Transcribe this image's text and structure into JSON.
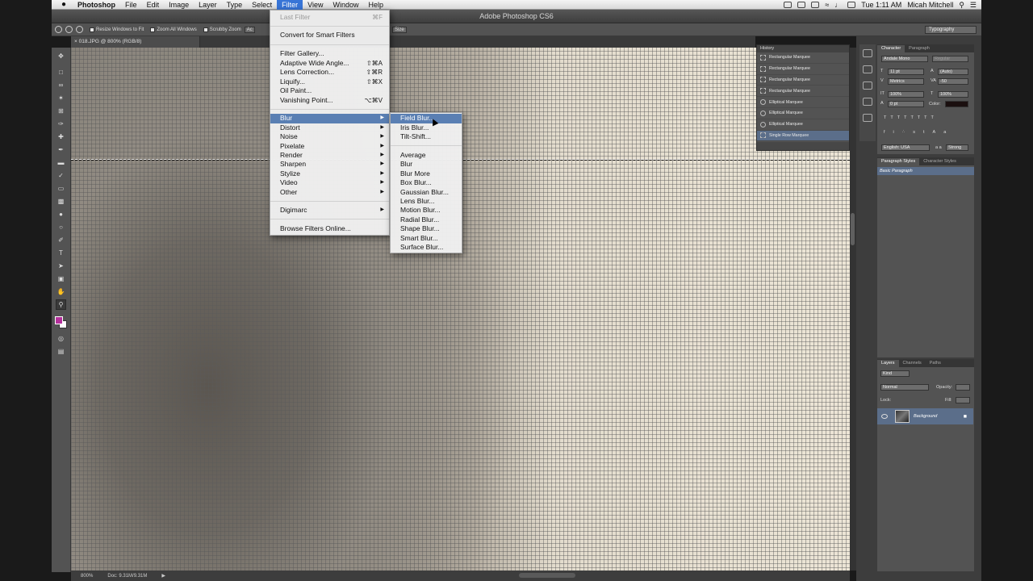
{
  "menubar": {
    "app": "Photoshop",
    "items": [
      "File",
      "Edit",
      "Image",
      "Layer",
      "Type",
      "Select",
      "Filter",
      "View",
      "Window",
      "Help"
    ],
    "active": "Filter",
    "clock": "Tue 1:11 AM",
    "user": "Micah Mitchell"
  },
  "window": {
    "title": "Adobe Photoshop CS6"
  },
  "options": {
    "resize": "Resize Windows to Fit",
    "zoom_all": "Zoom All Windows",
    "scrubby": "Scrubby Zoom",
    "actual": "Ac",
    "size": "Size",
    "workspace": "Typography"
  },
  "document": {
    "tab": "018.JPG @ 800% (RGB/8)",
    "zoom": "800%",
    "doc_size": "Doc: 9.31M/9.31M"
  },
  "filter_menu": {
    "last_filter": "Last Filter",
    "last_filter_sc": "⌘F",
    "smart": "Convert for Smart Filters",
    "gallery": "Filter Gallery...",
    "adaptive": "Adaptive Wide Angle...",
    "adaptive_sc": "⇧⌘A",
    "lens": "Lens Correction...",
    "lens_sc": "⇧⌘R",
    "liquify": "Liquify...",
    "liquify_sc": "⇧⌘X",
    "oil": "Oil Paint...",
    "vanish": "Vanishing Point...",
    "vanish_sc": "⌥⌘V",
    "groups": [
      "Blur",
      "Distort",
      "Noise",
      "Pixelate",
      "Render",
      "Sharpen",
      "Stylize",
      "Video",
      "Other"
    ],
    "digimarc": "Digimarc",
    "browse": "Browse Filters Online..."
  },
  "blur_menu": {
    "gallery": [
      "Field Blur...",
      "Iris Blur...",
      "Tilt-Shift..."
    ],
    "filters": [
      "Average",
      "Blur",
      "Blur More",
      "Box Blur...",
      "Gaussian Blur...",
      "Lens Blur...",
      "Motion Blur...",
      "Radial Blur...",
      "Shape Blur...",
      "Smart Blur...",
      "Surface Blur..."
    ]
  },
  "history": {
    "title": "History",
    "items": [
      "Rectangular Marquee",
      "Rectangular Marquee",
      "Rectangular Marquee",
      "Rectangular Marquee",
      "Elliptical Marquee",
      "Elliptical Marquee",
      "Elliptical Marquee",
      "Single Row Marquee"
    ]
  },
  "character": {
    "tabs": [
      "Character",
      "Paragraph"
    ],
    "font": "Andale Mono",
    "style": "Regular",
    "size": "11 pt",
    "leading": "(Auto)",
    "kerning": "Metrics",
    "tracking": "-50",
    "vscale": "100%",
    "hscale": "100%",
    "baseline": "0 pt",
    "color_label": "Color:",
    "language": "English: USA",
    "aa": "Strong",
    "aa_prefix": "a a"
  },
  "styles": {
    "tabs": [
      "Paragraph Styles",
      "Character Styles"
    ],
    "item": "Basic Paragraph"
  },
  "layers": {
    "tabs": [
      "Layers",
      "Channels",
      "Paths"
    ],
    "kind": "Kind",
    "blend": "Normal",
    "opacity_label": "Opacity:",
    "lock_label": "Lock:",
    "fill_label": "Fill:",
    "layer": "Background"
  },
  "colors": {
    "foreground": "#b4309c",
    "highlight": "#5a7fb3"
  }
}
